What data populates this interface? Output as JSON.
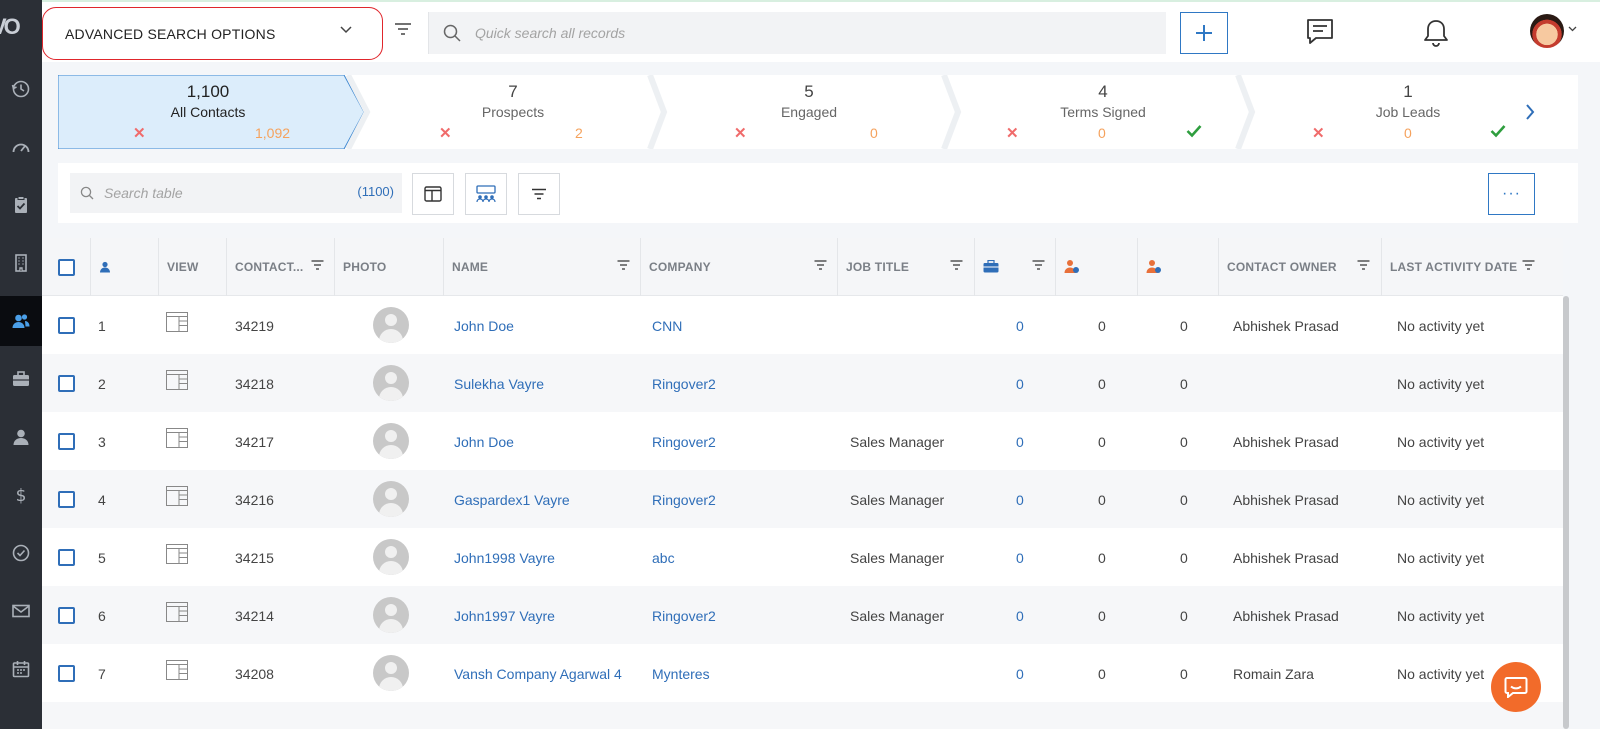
{
  "sidebar": {
    "logo": "VO",
    "items": [
      {
        "icon": "history-icon"
      },
      {
        "icon": "dashboard-icon"
      },
      {
        "icon": "clipboard-check-icon"
      },
      {
        "icon": "building-icon"
      },
      {
        "icon": "contacts-icon",
        "active": true
      },
      {
        "icon": "briefcase-icon"
      },
      {
        "icon": "user-icon"
      },
      {
        "icon": "dollar-icon"
      },
      {
        "icon": "check-circle-icon"
      },
      {
        "icon": "mail-icon"
      },
      {
        "icon": "calendar-icon"
      }
    ]
  },
  "header": {
    "advanced_search": "ADVANCED SEARCH OPTIONS",
    "search_placeholder": "Quick search all records"
  },
  "pipeline": [
    {
      "count": "1,100",
      "label": "All Contacts",
      "value": "1,092",
      "active": true
    },
    {
      "count": "7",
      "label": "Prospects",
      "value": "2"
    },
    {
      "count": "5",
      "label": "Engaged",
      "value": "0"
    },
    {
      "count": "4",
      "label": "Terms Signed",
      "value": "0",
      "check": true
    },
    {
      "count": "1",
      "label": "Job Leads",
      "value": "0",
      "check": true
    }
  ],
  "toolbar": {
    "search_placeholder": "Search table",
    "count": "(1100)",
    "more": "···"
  },
  "table": {
    "headers": {
      "view": "VIEW",
      "contact": "CONTACT...",
      "photo": "PHOTO",
      "name": "NAME",
      "company": "COMPANY",
      "job_title": "JOB TITLE",
      "contact_owner": "CONTACT OWNER",
      "last_activity": "LAST ACTIVITY DATE"
    },
    "rows": [
      {
        "num": "1",
        "id": "34219",
        "name": "John Doe",
        "company": "CNN",
        "job_title": "",
        "c1": "0",
        "c2": "0",
        "c3": "0",
        "owner": "Abhishek Prasad",
        "activity": "No activity yet"
      },
      {
        "num": "2",
        "id": "34218",
        "name": "Sulekha Vayre",
        "company": "Ringover2",
        "job_title": "",
        "c1": "0",
        "c2": "0",
        "c3": "0",
        "owner": "",
        "activity": "No activity yet"
      },
      {
        "num": "3",
        "id": "34217",
        "name": "John Doe",
        "company": "Ringover2",
        "job_title": "Sales Manager",
        "c1": "0",
        "c2": "0",
        "c3": "0",
        "owner": "Abhishek Prasad",
        "activity": "No activity yet"
      },
      {
        "num": "4",
        "id": "34216",
        "name": "Gaspardex1 Vayre",
        "company": "Ringover2",
        "job_title": "Sales Manager",
        "c1": "0",
        "c2": "0",
        "c3": "0",
        "owner": "Abhishek Prasad",
        "activity": "No activity yet"
      },
      {
        "num": "5",
        "id": "34215",
        "name": "John1998 Vayre",
        "company": "abc",
        "job_title": "Sales Manager",
        "c1": "0",
        "c2": "0",
        "c3": "0",
        "owner": "Abhishek Prasad",
        "activity": "No activity yet"
      },
      {
        "num": "6",
        "id": "34214",
        "name": "John1997 Vayre",
        "company": "Ringover2",
        "job_title": "Sales Manager",
        "c1": "0",
        "c2": "0",
        "c3": "0",
        "owner": "Abhishek Prasad",
        "activity": "No activity yet"
      },
      {
        "num": "7",
        "id": "34208",
        "name": "Vansh Company Agarwal 4",
        "company": "Mynteres",
        "job_title": "",
        "c1": "0",
        "c2": "0",
        "c3": "0",
        "owner": "Romain Zara",
        "activity": "No activity yet"
      }
    ]
  },
  "colors": {
    "accent": "#2f6eb8",
    "danger": "#f06b6b",
    "warning": "#f5a25d",
    "success": "#2e9e3e",
    "sidebar": "#2b2f36",
    "fab": "#f26b2a"
  }
}
